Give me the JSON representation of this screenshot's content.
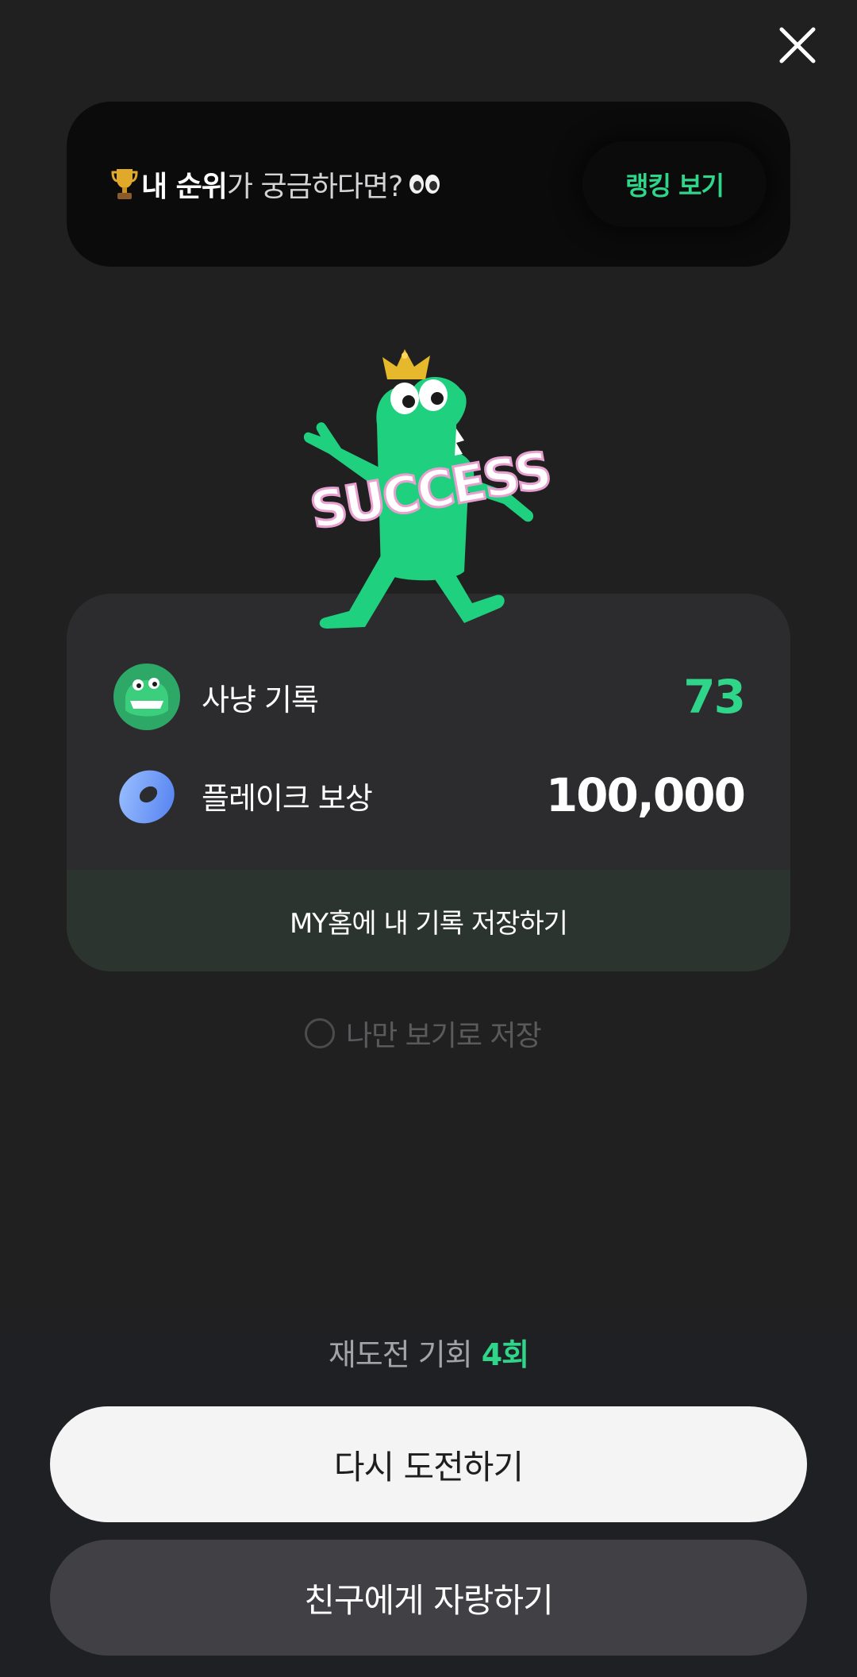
{
  "header": {
    "close_icon": "close-icon"
  },
  "rank_banner": {
    "trophy_icon": "trophy-icon",
    "bold_text": "내 순위",
    "rest_text": "가 궁금하다면?",
    "eyes_icon": "eyes-icon",
    "button_label": "랭킹 보기",
    "accent_color": "#2fd68a"
  },
  "mascot": {
    "badge_text": "SUCCESS"
  },
  "result": {
    "rows": [
      {
        "icon": "dino-avatar-icon",
        "label": "사냥 기록",
        "value": "73",
        "value_color": "#2fd68a"
      },
      {
        "icon": "donut-icon",
        "label": "플레이크 보상",
        "value": "100,000",
        "value_color": "#ffffff"
      }
    ],
    "save_button_label": "MY홈에 내 기록 저장하기"
  },
  "private_option": {
    "label": "나만 보기로 저장",
    "checked": false
  },
  "retry": {
    "label": "재도전 기회",
    "count": "4회"
  },
  "buttons": {
    "retry_label": "다시 도전하기",
    "share_label": "친구에게 자랑하기"
  }
}
